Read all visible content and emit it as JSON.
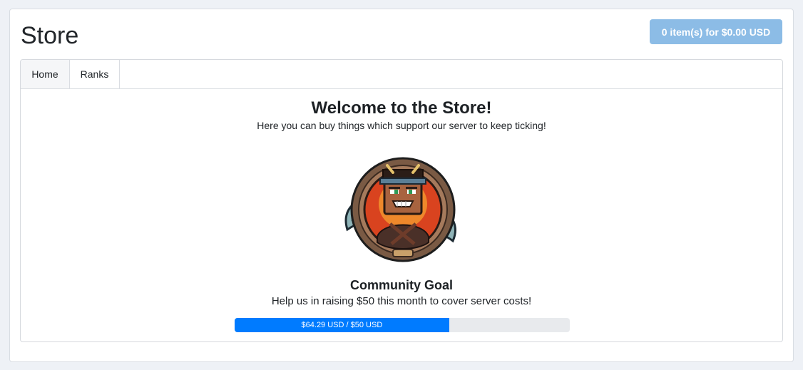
{
  "header": {
    "title": "Store",
    "cart_label": "0 item(s) for $0.00 USD"
  },
  "tabs": [
    {
      "label": "Home",
      "active": true
    },
    {
      "label": "Ranks",
      "active": false
    }
  ],
  "welcome": {
    "title": "Welcome to the Store!",
    "subtitle": "Here you can buy things which support our server to keep ticking!"
  },
  "logo": {
    "icon": "server-mascot-logo"
  },
  "goal": {
    "title": "Community Goal",
    "description": "Help us in raising $50 this month to cover server costs!",
    "raised": 64.29,
    "target": 50,
    "fill_percent": 64,
    "label": "$64.29 USD / $50 USD"
  },
  "colors": {
    "cart_button": "#8cbce6",
    "progress_fill": "#007bff",
    "progress_track": "#e8eaed"
  }
}
